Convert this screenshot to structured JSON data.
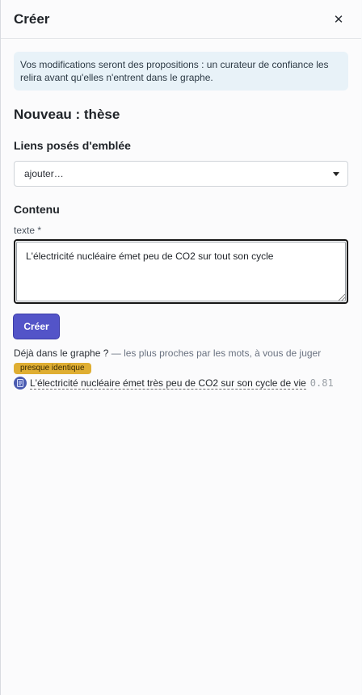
{
  "header": {
    "title": "Créer",
    "close_glyph": "✕"
  },
  "notice": {
    "text": "Vos modifications seront des propositions : un curateur de confiance les relira avant qu'elles n'entrent dans le graphe."
  },
  "form": {
    "type_title": "Nouveau : thèse",
    "links_section_title": "Liens posés d'emblée",
    "links_select_value": "ajouter…",
    "content_section_title": "Contenu",
    "text_label": "texte *",
    "text_value": "L'électricité nucléaire émet peu de CO2 sur tout son cycle",
    "create_label": "Créer"
  },
  "similar": {
    "question": "Déjà dans le graphe ?",
    "hint": " — les plus proches par les mots, à vous de juger",
    "badge": "presque identique",
    "items": [
      {
        "icon": "document-icon",
        "text": "L'électricité nucléaire émet très peu de CO2 sur son cycle de vie",
        "score": "0.81"
      }
    ]
  },
  "colors": {
    "accent": "#5354c8",
    "badge": "#dfae32",
    "notice_bg": "#e8f2f8",
    "node_icon": "#4a5bb0"
  }
}
